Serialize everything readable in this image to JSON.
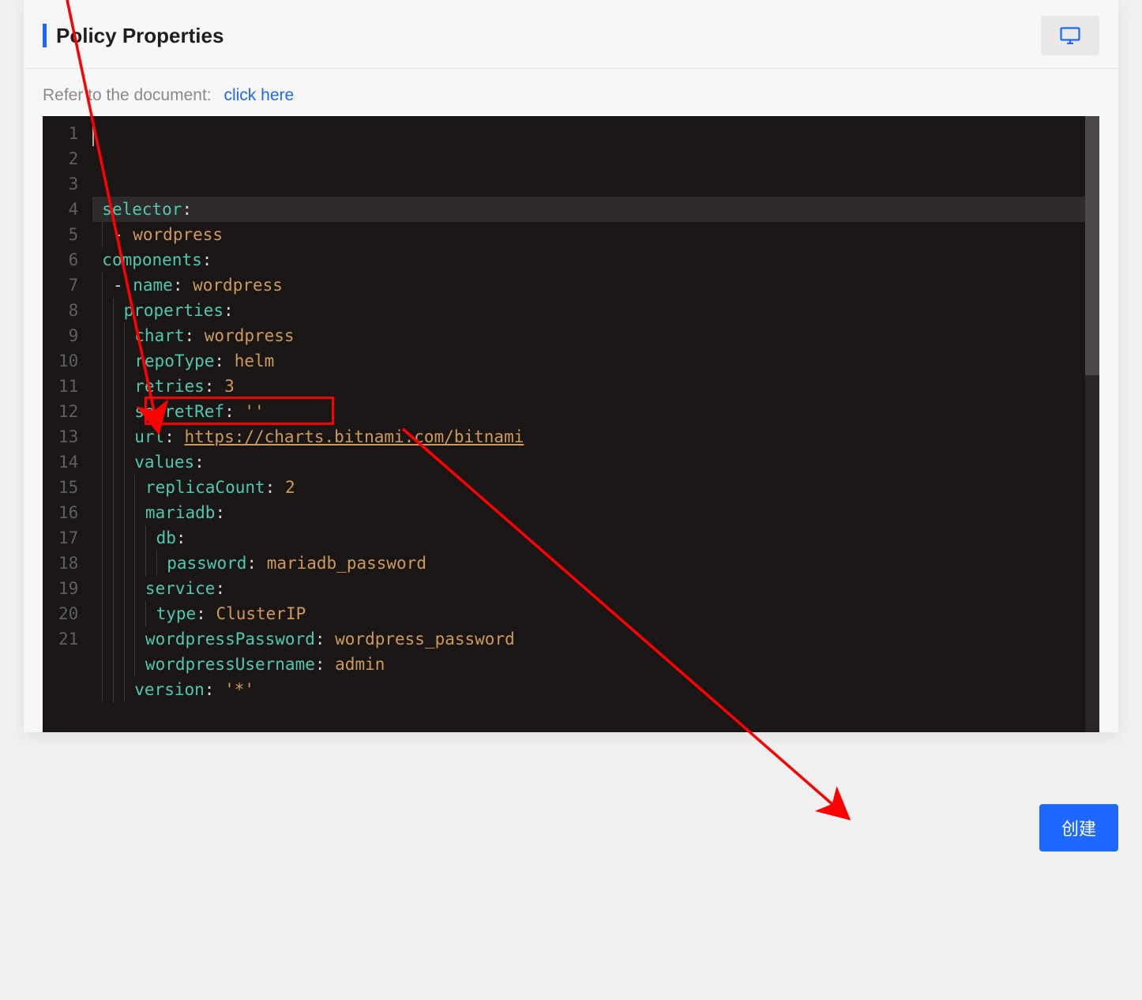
{
  "header": {
    "title": "Policy Properties"
  },
  "doc": {
    "label": "Refer to the document:",
    "link": "click here"
  },
  "editor": {
    "lines": [
      {
        "num": "1",
        "tokens": [
          {
            "t": "selector",
            "c": "k-key"
          },
          {
            "t": ":",
            "c": "k-colon"
          }
        ]
      },
      {
        "num": "2",
        "indent": 1,
        "tokens": [
          {
            "t": "- ",
            "c": "k-dash"
          },
          {
            "t": "wordpress",
            "c": "k-str"
          }
        ]
      },
      {
        "num": "3",
        "tokens": [
          {
            "t": "components",
            "c": "k-key"
          },
          {
            "t": ":",
            "c": "k-colon"
          }
        ]
      },
      {
        "num": "4",
        "indent": 1,
        "tokens": [
          {
            "t": "- ",
            "c": "k-dash"
          },
          {
            "t": "name",
            "c": "k-key"
          },
          {
            "t": ": ",
            "c": "k-colon"
          },
          {
            "t": "wordpress",
            "c": "k-str"
          }
        ]
      },
      {
        "num": "5",
        "indent": 2,
        "tokens": [
          {
            "t": "properties",
            "c": "k-key"
          },
          {
            "t": ":",
            "c": "k-colon"
          }
        ]
      },
      {
        "num": "6",
        "indent": 3,
        "tokens": [
          {
            "t": "chart",
            "c": "k-key"
          },
          {
            "t": ": ",
            "c": "k-colon"
          },
          {
            "t": "wordpress",
            "c": "k-str"
          }
        ]
      },
      {
        "num": "7",
        "indent": 3,
        "tokens": [
          {
            "t": "repoType",
            "c": "k-key"
          },
          {
            "t": ": ",
            "c": "k-colon"
          },
          {
            "t": "helm",
            "c": "k-str"
          }
        ]
      },
      {
        "num": "8",
        "indent": 3,
        "tokens": [
          {
            "t": "retries",
            "c": "k-key"
          },
          {
            "t": ": ",
            "c": "k-colon"
          },
          {
            "t": "3",
            "c": "k-str"
          }
        ]
      },
      {
        "num": "9",
        "indent": 3,
        "tokens": [
          {
            "t": "secretRef",
            "c": "k-key"
          },
          {
            "t": ": ",
            "c": "k-colon"
          },
          {
            "t": "''",
            "c": "k-str"
          }
        ]
      },
      {
        "num": "10",
        "indent": 3,
        "tokens": [
          {
            "t": "url",
            "c": "k-key"
          },
          {
            "t": ": ",
            "c": "k-colon"
          },
          {
            "t": "https://charts.bitnami.com/bitnami",
            "c": "k-url"
          }
        ]
      },
      {
        "num": "11",
        "indent": 3,
        "tokens": [
          {
            "t": "values",
            "c": "k-key"
          },
          {
            "t": ":",
            "c": "k-colon"
          }
        ]
      },
      {
        "num": "12",
        "indent": 4,
        "tokens": [
          {
            "t": "replicaCount",
            "c": "k-key"
          },
          {
            "t": ": ",
            "c": "k-colon"
          },
          {
            "t": "2",
            "c": "k-str"
          }
        ]
      },
      {
        "num": "13",
        "indent": 4,
        "tokens": [
          {
            "t": "mariadb",
            "c": "k-key"
          },
          {
            "t": ":",
            "c": "k-colon"
          }
        ]
      },
      {
        "num": "14",
        "indent": 5,
        "tokens": [
          {
            "t": "db",
            "c": "k-key"
          },
          {
            "t": ":",
            "c": "k-colon"
          }
        ]
      },
      {
        "num": "15",
        "indent": 6,
        "tokens": [
          {
            "t": "password",
            "c": "k-key"
          },
          {
            "t": ": ",
            "c": "k-colon"
          },
          {
            "t": "mariadb_password",
            "c": "k-str"
          }
        ]
      },
      {
        "num": "16",
        "indent": 4,
        "tokens": [
          {
            "t": "service",
            "c": "k-key"
          },
          {
            "t": ":",
            "c": "k-colon"
          }
        ]
      },
      {
        "num": "17",
        "indent": 5,
        "tokens": [
          {
            "t": "type",
            "c": "k-key"
          },
          {
            "t": ": ",
            "c": "k-colon"
          },
          {
            "t": "ClusterIP",
            "c": "k-str"
          }
        ]
      },
      {
        "num": "18",
        "indent": 4,
        "tokens": [
          {
            "t": "wordpressPassword",
            "c": "k-key"
          },
          {
            "t": ": ",
            "c": "k-colon"
          },
          {
            "t": "wordpress_password",
            "c": "k-str"
          }
        ]
      },
      {
        "num": "19",
        "indent": 4,
        "tokens": [
          {
            "t": "wordpressUsername",
            "c": "k-key"
          },
          {
            "t": ": ",
            "c": "k-colon"
          },
          {
            "t": "admin",
            "c": "k-str"
          }
        ]
      },
      {
        "num": "20",
        "indent": 3,
        "tokens": [
          {
            "t": "version",
            "c": "k-key"
          },
          {
            "t": ": ",
            "c": "k-colon"
          },
          {
            "t": "'*'",
            "c": "k-str"
          }
        ]
      },
      {
        "num": "21",
        "tokens": []
      }
    ],
    "highlight_line": 12
  },
  "buttons": {
    "create": "创建"
  }
}
